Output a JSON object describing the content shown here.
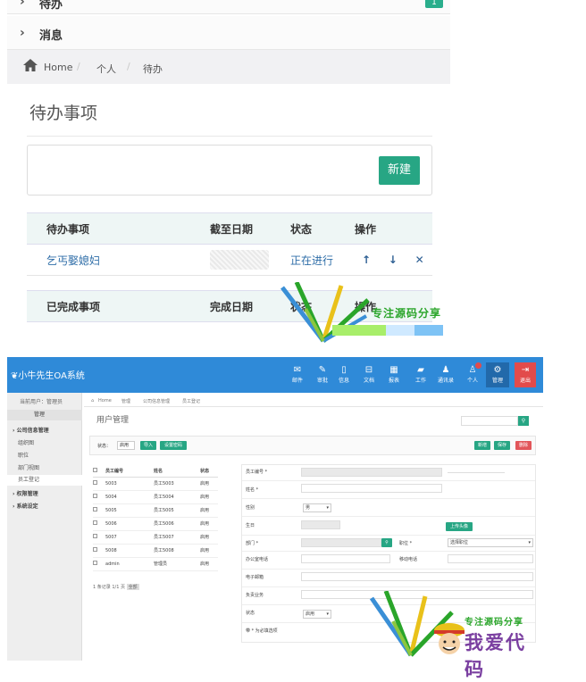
{
  "top": {
    "menu": [
      {
        "label": "待办",
        "badge": "1"
      },
      {
        "label": "消息"
      }
    ],
    "breadcrumb": [
      "Home",
      "个人",
      "待办"
    ],
    "page_title": "待办事项",
    "new_button": "新建",
    "todo_table": {
      "headers": [
        "待办事项",
        "截至日期",
        "状态",
        "操作"
      ],
      "rows": [
        {
          "name": "乞丐娶媳妇",
          "date": "",
          "status": "正在进行",
          "ops": [
            "↑",
            "↓",
            "✕"
          ]
        }
      ]
    },
    "done_table": {
      "headers": [
        "已完成事项",
        "完成日期",
        "状态",
        "操作"
      ]
    }
  },
  "watermark": {
    "text1": "专注源码分享",
    "text2": "专注源码分享",
    "text3": "我爱代码"
  },
  "oa": {
    "title": "小牛先生OA系统",
    "nav": [
      {
        "label": "邮件",
        "icon": "mail-icon"
      },
      {
        "label": "审批",
        "icon": "pencil-icon"
      },
      {
        "label": "信息",
        "icon": "file-icon"
      },
      {
        "label": "文档",
        "icon": "inbox-icon"
      },
      {
        "label": "报表",
        "icon": "grid-icon"
      },
      {
        "label": "工作",
        "icon": "book-icon"
      },
      {
        "label": "通讯录",
        "icon": "people-icon"
      },
      {
        "label": "个人",
        "icon": "person-icon"
      },
      {
        "label": "管理",
        "icon": "cogs-icon"
      },
      {
        "label": "退出",
        "icon": "logout-icon"
      }
    ],
    "sidebar": {
      "current_user": "当前用户：管理员",
      "role_select": "管理",
      "items": [
        {
          "label": "公司信息管理",
          "type": "group"
        },
        {
          "label": "组织图",
          "type": "sub"
        },
        {
          "label": "职位",
          "type": "sub"
        },
        {
          "label": "部门视图",
          "type": "sub"
        },
        {
          "label": "员工登记",
          "type": "sub"
        },
        {
          "label": "权限管理",
          "type": "group"
        },
        {
          "label": "系统设定",
          "type": "group"
        }
      ]
    },
    "breadcrumb": [
      "Home",
      "管理",
      "公司信息管理",
      "员工登记"
    ],
    "page_title": "用户管理",
    "toolbar": {
      "status_label": "状态：",
      "status_value": "启用",
      "import_btn": "导入",
      "set_password_btn": "设置密码",
      "add_btn": "新增",
      "save_btn": "保存",
      "delete_btn": "删除"
    },
    "user_table": {
      "headers": [
        "员工编号",
        "姓名",
        "状态"
      ],
      "rows": [
        [
          "5003",
          "员工5003",
          "启用"
        ],
        [
          "5004",
          "员工5004",
          "启用"
        ],
        [
          "5005",
          "员工5005",
          "启用"
        ],
        [
          "5006",
          "员工5006",
          "启用"
        ],
        [
          "5007",
          "员工5007",
          "启用"
        ],
        [
          "5008",
          "员工5008",
          "启用"
        ],
        [
          "admin",
          "管理员",
          "启用"
        ]
      ]
    },
    "pagination": {
      "text": "1 条记录  1/1  页",
      "btn": "全部"
    },
    "form": {
      "employee_no": "员工编号 *",
      "name": "姓名 *",
      "gender": "性别",
      "gender_value": "男",
      "birthday": "生日",
      "upload_avatar": "上传头像",
      "department": "部门 *",
      "position": "职位 *",
      "position_placeholder": "选择职位",
      "office_phone": "办公室电话",
      "mobile": "移动电话",
      "email": "电子邮箱",
      "duties": "负责业务",
      "status": "状态",
      "status_value": "启用",
      "footnote": "带 * 为必填选项"
    }
  }
}
